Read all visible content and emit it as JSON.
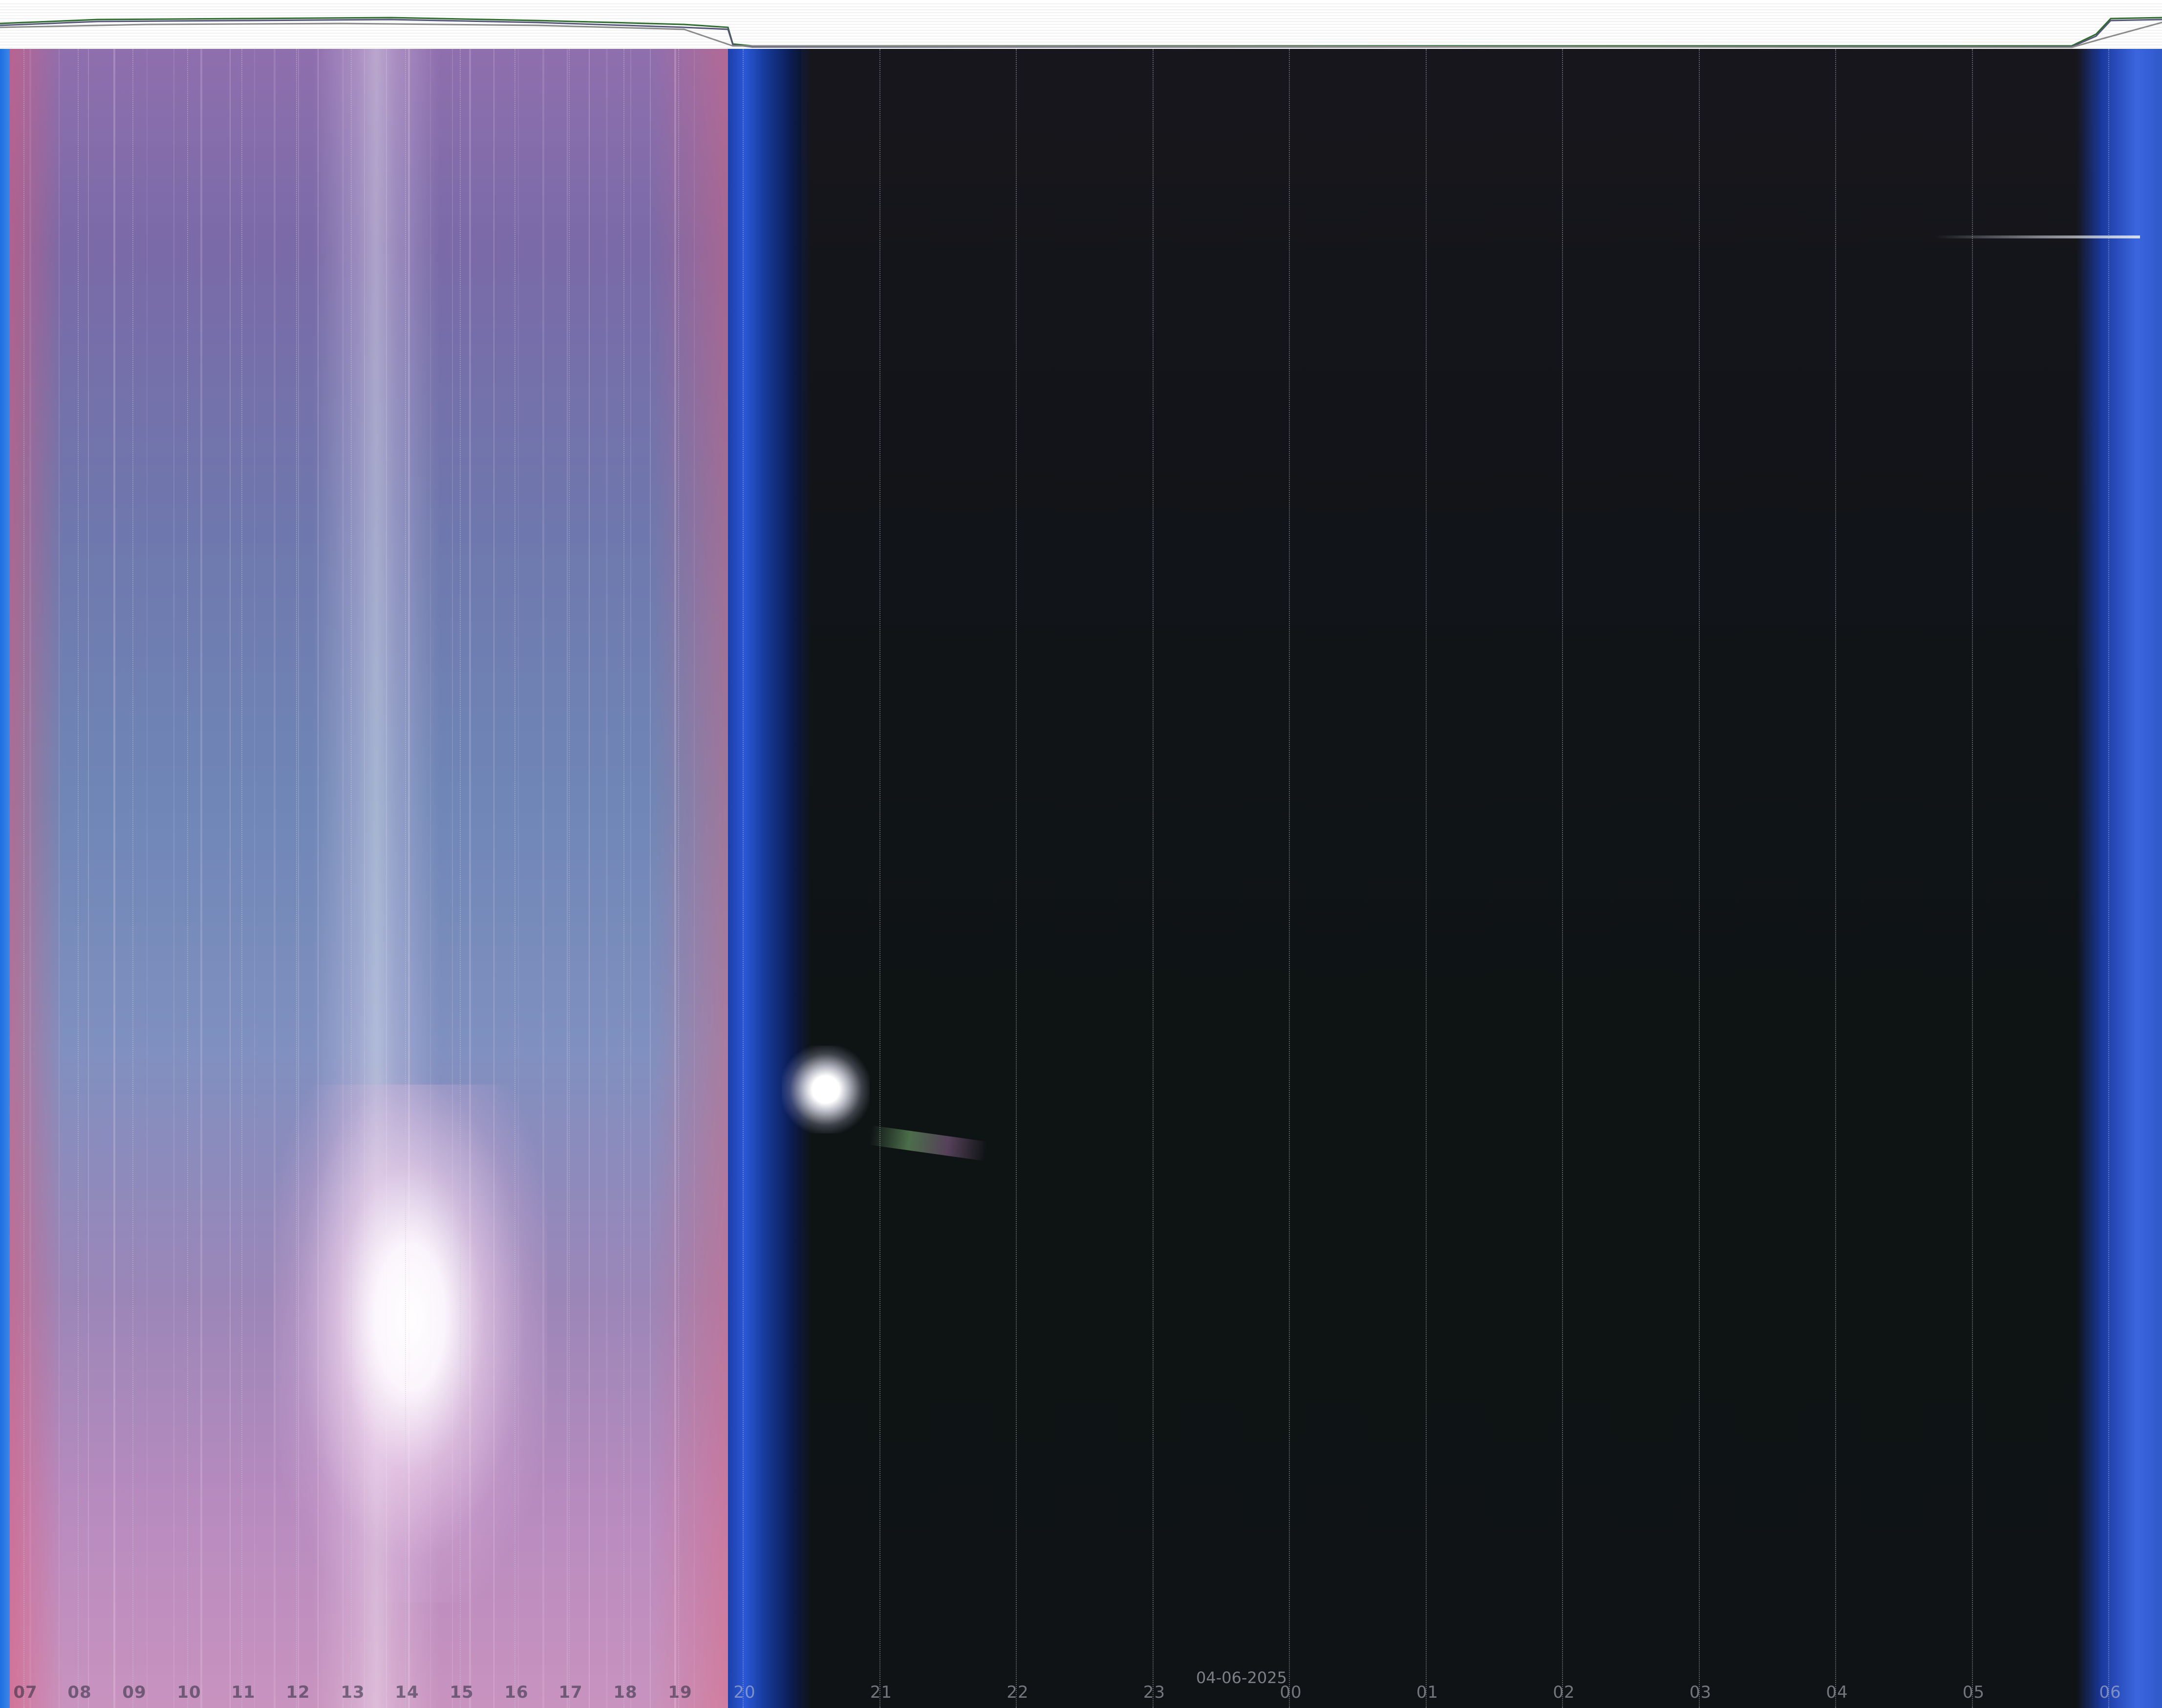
{
  "header": {
    "strip_background": "#ffffff",
    "plot_line_colors": [
      "#2e6b2e",
      "#555577",
      "#8a8a8a"
    ]
  },
  "image": {
    "description_icon": "keogram-icon",
    "colors": {
      "day_sky": "#7f86b6",
      "twilight_blue": "#2a57d6",
      "night_sky": "#0f1315",
      "sun_glare": "#ffffff"
    }
  },
  "timeline": {
    "date": "04-06-2025",
    "hours": [
      "07",
      "08",
      "09",
      "10",
      "11",
      "12",
      "13",
      "14",
      "15",
      "16",
      "17",
      "18",
      "19",
      "20",
      "21",
      "22",
      "23",
      "00",
      "01",
      "02",
      "03",
      "04",
      "05",
      "06"
    ]
  }
}
